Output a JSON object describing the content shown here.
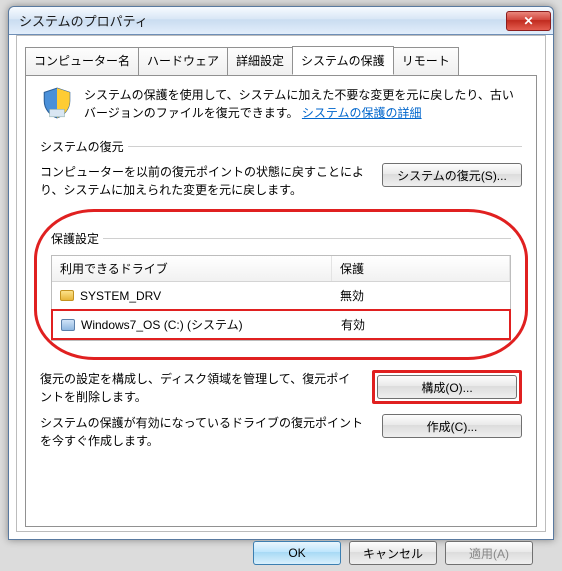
{
  "window": {
    "title": "システムのプロパティ"
  },
  "tabs": {
    "computer_name": "コンピューター名",
    "hardware": "ハードウェア",
    "advanced": "詳細設定",
    "system_protection": "システムの保護",
    "remote": "リモート"
  },
  "intro": {
    "text_prefix": "システムの保護を使用して、システムに加えた不要な変更を元に戻したり、古いバージョンのファイルを復元できます。",
    "link": "システムの保護の詳細"
  },
  "restore": {
    "section_title": "システムの復元",
    "desc": "コンピューターを以前の復元ポイントの状態に戻すことにより、システムに加えられた変更を元に戻します。",
    "button": "システムの復元(S)..."
  },
  "protection": {
    "section_title": "保護設定",
    "header_drive": "利用できるドライブ",
    "header_status": "保護",
    "rows": [
      {
        "name": "SYSTEM_DRV",
        "status": "無効"
      },
      {
        "name": "Windows7_OS (C:) (システム)",
        "status": "有効"
      }
    ],
    "config_desc": "復元の設定を構成し、ディスク領域を管理して、復元ポイントを削除します。",
    "config_button": "構成(O)...",
    "create_desc": "システムの保護が有効になっているドライブの復元ポイントを今すぐ作成します。",
    "create_button": "作成(C)..."
  },
  "footer": {
    "ok": "OK",
    "cancel": "キャンセル",
    "apply": "適用(A)"
  }
}
